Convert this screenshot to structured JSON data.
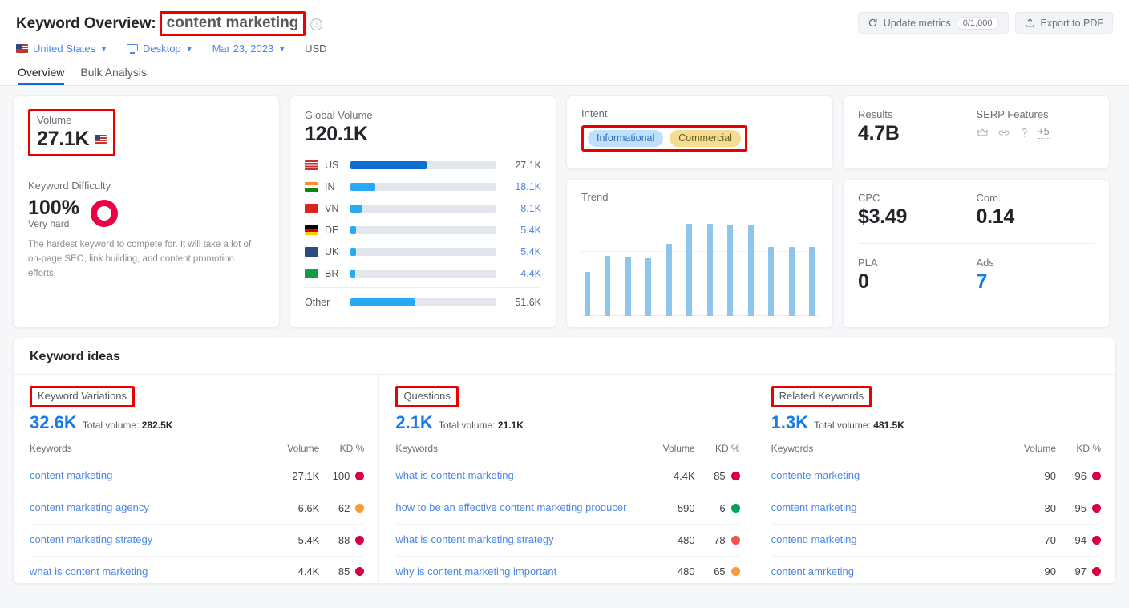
{
  "header": {
    "title_prefix": "Keyword Overview:",
    "keyword": "content marketing",
    "info_icon": "info-icon",
    "update_metrics_label": "Update metrics",
    "update_metrics_count": "0/1,000",
    "export_label": "Export to PDF",
    "refresh_icon": "refresh-icon",
    "export_icon": "upload-icon",
    "filters": {
      "country": "United States",
      "device": "Desktop",
      "date": "Mar 23, 2023",
      "currency": "USD"
    },
    "tabs": [
      {
        "label": "Overview",
        "active": true
      },
      {
        "label": "Bulk Analysis",
        "active": false
      }
    ]
  },
  "volume_card": {
    "volume_label": "Volume",
    "volume_value": "27.1K",
    "flag": "us-flag-icon",
    "kd_label": "Keyword Difficulty",
    "kd_value": "100%",
    "kd_rating": "Very hard",
    "kd_color": "#eb0046",
    "kd_description": "The hardest keyword to compete for. It will take a lot of on-page SEO, link building, and content promotion efforts."
  },
  "global_volume": {
    "label": "Global Volume",
    "value": "120.1K",
    "other_label": "Other",
    "other_value": "51.6K",
    "rows": [
      {
        "code": "US",
        "value": "27.1K",
        "pct": 52,
        "highlight": true
      },
      {
        "code": "IN",
        "value": "18.1K",
        "pct": 17,
        "highlight": false
      },
      {
        "code": "VN",
        "value": "8.1K",
        "pct": 7.5,
        "highlight": false
      },
      {
        "code": "DE",
        "value": "5.4K",
        "pct": 4,
        "highlight": false
      },
      {
        "code": "UK",
        "value": "5.4K",
        "pct": 4,
        "highlight": false
      },
      {
        "code": "BR",
        "value": "4.4K",
        "pct": 3.5,
        "highlight": false
      }
    ],
    "other_pct": 44
  },
  "intent": {
    "label": "Intent",
    "badges": [
      {
        "label": "Informational",
        "color": "#bfe0fb"
      },
      {
        "label": "Commercial",
        "color": "#f4dd90"
      }
    ]
  },
  "trend": {
    "label": "Trend",
    "bar_color": "#8ec5ea"
  },
  "results": {
    "results_label": "Results",
    "results_value": "4.7B",
    "serp_label": "SERP Features",
    "serp_icons": [
      "crown-icon",
      "link-icon",
      "question-icon"
    ],
    "serp_more": "+5"
  },
  "cpc": {
    "cpc_label": "CPC",
    "cpc_value": "$3.49",
    "com_label": "Com.",
    "com_value": "0.14",
    "pla_label": "PLA",
    "pla_value": "0",
    "ads_label": "Ads",
    "ads_value": "7"
  },
  "keyword_ideas": {
    "heading": "Keyword ideas",
    "columns": [
      {
        "title": "Keyword Variations",
        "count": "32.6K",
        "total_label": "Total volume:",
        "total_value": "282.5K",
        "headers": {
          "keywords": "Keywords",
          "volume": "Volume",
          "kd": "KD %"
        },
        "rows": [
          {
            "keyword": "content marketing",
            "volume": "27.1K",
            "kd": "100",
            "kd_color": "#d70040"
          },
          {
            "keyword": "content marketing agency",
            "volume": "6.6K",
            "kd": "62",
            "kd_color": "#f89c3a"
          },
          {
            "keyword": "content marketing strategy",
            "volume": "5.4K",
            "kd": "88",
            "kd_color": "#d70040"
          },
          {
            "keyword": "what is content marketing",
            "volume": "4.4K",
            "kd": "85",
            "kd_color": "#d70040"
          }
        ]
      },
      {
        "title": "Questions",
        "count": "2.1K",
        "total_label": "Total volume:",
        "total_value": "21.1K",
        "headers": {
          "keywords": "Keywords",
          "volume": "Volume",
          "kd": "KD %"
        },
        "rows": [
          {
            "keyword": "what is content marketing",
            "volume": "4.4K",
            "kd": "85",
            "kd_color": "#d70040"
          },
          {
            "keyword": "how to be an effective content marketing producer",
            "volume": "590",
            "kd": "6",
            "kd_color": "#00a35c"
          },
          {
            "keyword": "what is content marketing strategy",
            "volume": "480",
            "kd": "78",
            "kd_color": "#f2544f"
          },
          {
            "keyword": "why is content marketing important",
            "volume": "480",
            "kd": "65",
            "kd_color": "#f89c3a"
          }
        ]
      },
      {
        "title": "Related Keywords",
        "count": "1.3K",
        "total_label": "Total volume:",
        "total_value": "481.5K",
        "headers": {
          "keywords": "Keywords",
          "volume": "Volume",
          "kd": "KD %"
        },
        "rows": [
          {
            "keyword": "contente marketing",
            "volume": "90",
            "kd": "96",
            "kd_color": "#d70040"
          },
          {
            "keyword": "comtent marketing",
            "volume": "30",
            "kd": "95",
            "kd_color": "#d70040"
          },
          {
            "keyword": "contend marketing",
            "volume": "70",
            "kd": "94",
            "kd_color": "#d70040"
          },
          {
            "keyword": "content amrketing",
            "volume": "90",
            "kd": "97",
            "kd_color": "#d70040"
          }
        ]
      }
    ]
  },
  "chart_data": {
    "type": "bar",
    "title": "Trend",
    "categories": [
      "1",
      "2",
      "3",
      "4",
      "5",
      "6",
      "7",
      "8",
      "9",
      "10",
      "11",
      "12"
    ],
    "values": [
      44,
      60,
      59,
      58,
      72,
      92,
      92,
      91,
      91,
      69,
      69,
      69
    ],
    "xlabel": "",
    "ylabel": "",
    "ylim": [
      0,
      100
    ],
    "grid": true,
    "legend": "none",
    "color": "#8ec5ea"
  }
}
